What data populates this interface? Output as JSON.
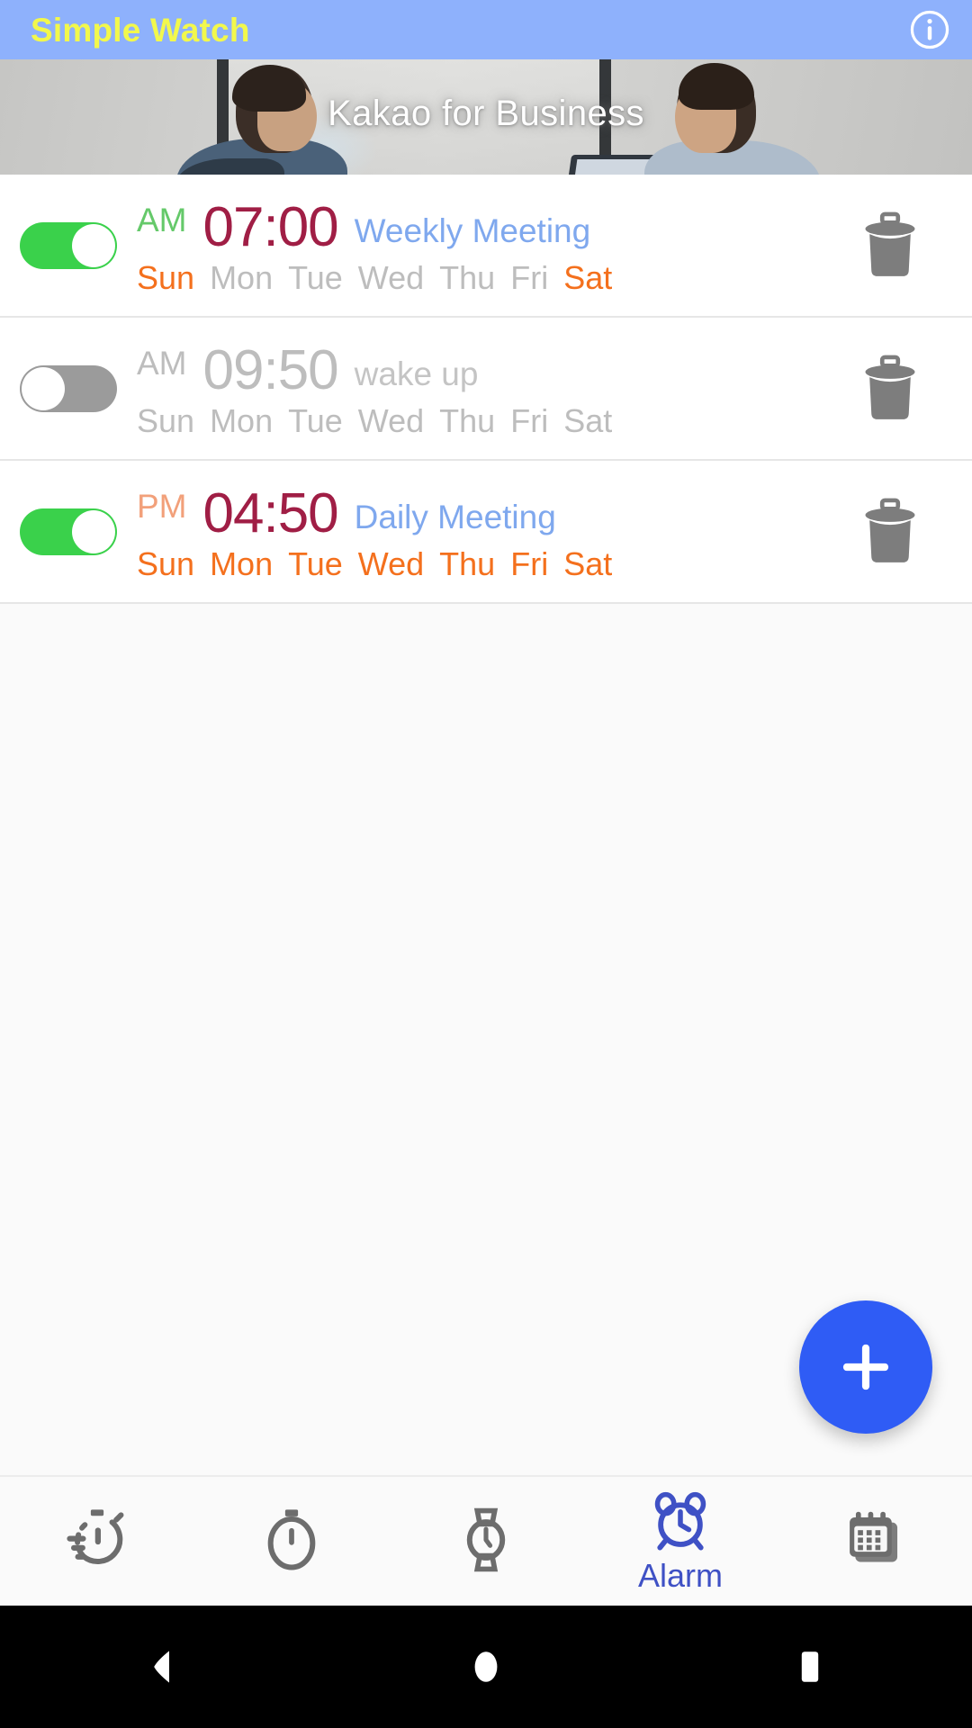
{
  "appbar": {
    "title": "Simple Watch",
    "info_icon": "info-circle-icon"
  },
  "ad": {
    "text": "Kakao for Business"
  },
  "alarms": [
    {
      "enabled": true,
      "meridiem": "AM",
      "time": "07:00",
      "label": "Weekly Meeting",
      "days": [
        {
          "name": "Sun",
          "active": true
        },
        {
          "name": "Mon",
          "active": false
        },
        {
          "name": "Tue",
          "active": false
        },
        {
          "name": "Wed",
          "active": false
        },
        {
          "name": "Thu",
          "active": false
        },
        {
          "name": "Fri",
          "active": false
        },
        {
          "name": "Sat",
          "active": true
        }
      ]
    },
    {
      "enabled": false,
      "meridiem": "AM",
      "time": "09:50",
      "label": "wake up",
      "days": [
        {
          "name": "Sun",
          "active": false
        },
        {
          "name": "Mon",
          "active": false
        },
        {
          "name": "Tue",
          "active": false
        },
        {
          "name": "Wed",
          "active": false
        },
        {
          "name": "Thu",
          "active": false
        },
        {
          "name": "Fri",
          "active": false
        },
        {
          "name": "Sat",
          "active": false
        }
      ]
    },
    {
      "enabled": true,
      "meridiem": "PM",
      "time": "04:50",
      "label": "Daily Meeting",
      "days": [
        {
          "name": "Sun",
          "active": true
        },
        {
          "name": "Mon",
          "active": true
        },
        {
          "name": "Tue",
          "active": true
        },
        {
          "name": "Wed",
          "active": true
        },
        {
          "name": "Thu",
          "active": true
        },
        {
          "name": "Fri",
          "active": true
        },
        {
          "name": "Sat",
          "active": true
        }
      ]
    }
  ],
  "fab": {
    "icon": "plus-icon",
    "label": "Add alarm"
  },
  "bottom_nav": [
    {
      "icon": "lap-timer-icon",
      "label": "",
      "active": false
    },
    {
      "icon": "stopwatch-icon",
      "label": "",
      "active": false
    },
    {
      "icon": "watch-icon",
      "label": "",
      "active": false
    },
    {
      "icon": "alarm-clock-icon",
      "label": "Alarm",
      "active": true
    },
    {
      "icon": "calendar-icon",
      "label": "",
      "active": false
    }
  ],
  "system_nav": [
    {
      "icon": "back-triangle-icon"
    },
    {
      "icon": "home-circle-icon"
    },
    {
      "icon": "recents-square-icon"
    }
  ],
  "colors": {
    "appbar_bg": "#8eb1fc",
    "title": "#f2f84c",
    "toggle_on": "#3ad14b",
    "toggle_off": "#9b9b9b",
    "time_on": "#a01e45",
    "time_off": "#bdbdbd",
    "label_on": "#7fa8ee",
    "day_active": "#f4701d",
    "day_inactive": "#bdbdbd",
    "am_on": "#65c96a",
    "pm_on": "#f2a07a",
    "fab_bg": "#2f5cf5",
    "nav_active": "#3f51c5",
    "nav_inactive": "#6d6d6d",
    "trash": "#7d7d7d"
  }
}
